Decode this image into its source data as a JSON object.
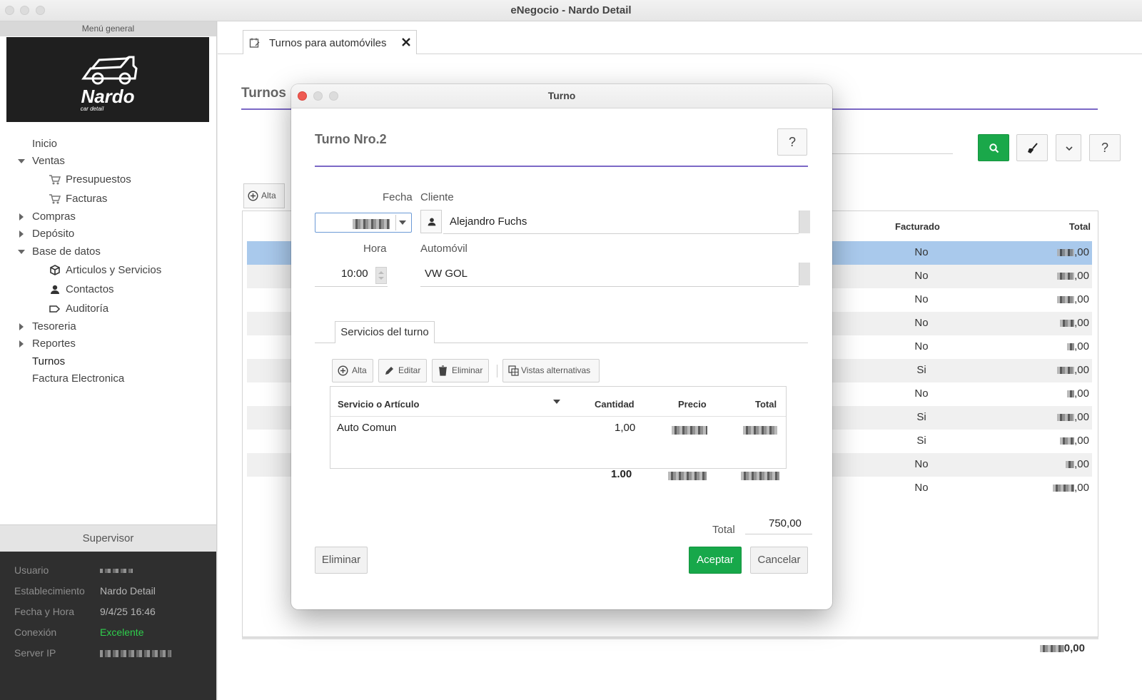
{
  "window": {
    "title": "eNegocio - Nardo Detail"
  },
  "sidebar": {
    "header": "Menú general",
    "logo_text": "Nardo car detail",
    "items": [
      {
        "label": "Inicio",
        "icon": ""
      },
      {
        "label": "Ventas",
        "expanded": true
      },
      {
        "label": "Presupuestos",
        "icon": "cart-icon"
      },
      {
        "label": "Facturas",
        "icon": "cart-icon"
      },
      {
        "label": "Compras",
        "expanded": false
      },
      {
        "label": "Depósito",
        "expanded": false
      },
      {
        "label": "Base de datos",
        "expanded": true
      },
      {
        "label": "Articulos y Servicios",
        "icon": "box-icon"
      },
      {
        "label": "Contactos",
        "icon": "person-icon"
      },
      {
        "label": "Auditoría",
        "icon": "tag-icon"
      },
      {
        "label": "Tesoreria",
        "expanded": false
      },
      {
        "label": "Reportes",
        "expanded": false
      },
      {
        "label": "Turnos"
      },
      {
        "label": "Factura Electronica"
      }
    ]
  },
  "session": {
    "title": "Supervisor",
    "usuario_label": "Usuario",
    "establecimiento_label": "Establecimiento",
    "establecimiento_value": "Nardo Detail",
    "fecha_label": "Fecha y Hora",
    "fecha_value": "9/4/25 16:46",
    "conexion_label": "Conexión",
    "conexion_value": "Excelente",
    "conexion_color": "#2fcf4c",
    "server_label": "Server IP"
  },
  "main": {
    "tab_label": "Turnos para automóviles",
    "heading": "Turnos",
    "alta_label": "Alta",
    "help_label": "?",
    "columns": {
      "facturado": "Facturado",
      "total": "Total"
    },
    "rows": [
      {
        "facturado": "No",
        "total": ",00"
      },
      {
        "facturado": "No",
        "total": ",00"
      },
      {
        "facturado": "No",
        "total": ",00"
      },
      {
        "facturado": "No",
        "total": ",00"
      },
      {
        "facturado": "No",
        "total": ",00"
      },
      {
        "facturado": "Si",
        "total": ",00"
      },
      {
        "facturado": "No",
        "total": ",00"
      },
      {
        "facturado": "Si",
        "total": ",00"
      },
      {
        "facturado": "Si",
        "total": ",00"
      },
      {
        "facturado": "No",
        "total": ",00"
      },
      {
        "facturado": "No",
        "total": ",00"
      }
    ],
    "grand_total": "0,00",
    "accent": "#7b68c6"
  },
  "dialog": {
    "title": "Turno",
    "heading": "Turno Nro.2",
    "help_label": "?",
    "fecha_label": "Fecha",
    "cliente_label": "Cliente",
    "cliente_value": "Alejandro Fuchs",
    "hora_label": "Hora",
    "hora_value": "10:00",
    "automovil_label": "Automóvil",
    "automovil_value": "VW GOL",
    "services_tab": "Servicios del turno",
    "toolbar": {
      "alta": "Alta",
      "editar": "Editar",
      "eliminar": "Eliminar",
      "vistas": "Vistas alternativas"
    },
    "services_columns": {
      "servicio": "Servicio o Artículo",
      "cantidad": "Cantidad",
      "precio": "Precio",
      "total": "Total"
    },
    "services_rows": [
      {
        "servicio": "Auto Comun",
        "cantidad": "1,00"
      }
    ],
    "services_footer": {
      "cantidad": "1.00"
    },
    "total_label": "Total",
    "total_value": "750,00",
    "buttons": {
      "eliminar": "Eliminar",
      "aceptar": "Aceptar",
      "cancelar": "Cancelar"
    },
    "accent": "#17a84a"
  }
}
